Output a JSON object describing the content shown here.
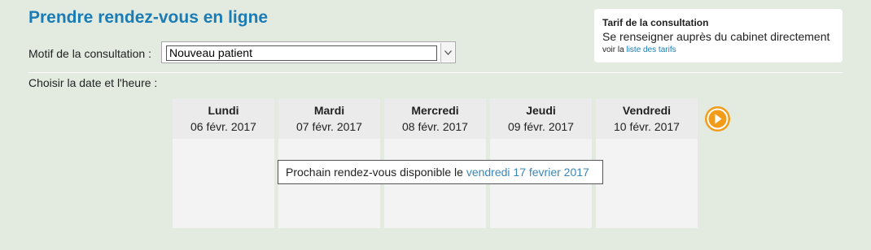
{
  "page": {
    "title": "Prendre rendez-vous en ligne"
  },
  "motif": {
    "label": "Motif de la consultation :",
    "selected": "Nouveau patient"
  },
  "tarif": {
    "title": "Tarif de la consultation",
    "text": "Se renseigner auprès du cabinet directement",
    "link_prefix": "voir la",
    "link_text": "liste des tarifs"
  },
  "calendar": {
    "label": "Choisir la date et l'heure :",
    "days": [
      {
        "name": "Lundi",
        "date": "06 févr. 2017"
      },
      {
        "name": "Mardi",
        "date": "07 févr. 2017"
      },
      {
        "name": "Mercredi",
        "date": "08 févr. 2017"
      },
      {
        "name": "Jeudi",
        "date": "09 févr. 2017"
      },
      {
        "name": "Vendredi",
        "date": "10 févr. 2017"
      }
    ],
    "next_icon": "chevron-right-icon",
    "next_available_prefix": "Prochain rendez-vous disponible le",
    "next_available_link": "vendredi 17 fevrier 2017"
  },
  "colors": {
    "background": "#e3ebe1",
    "title": "#1a7bb5",
    "accent": "#f39c19",
    "link": "#3a86b8"
  }
}
